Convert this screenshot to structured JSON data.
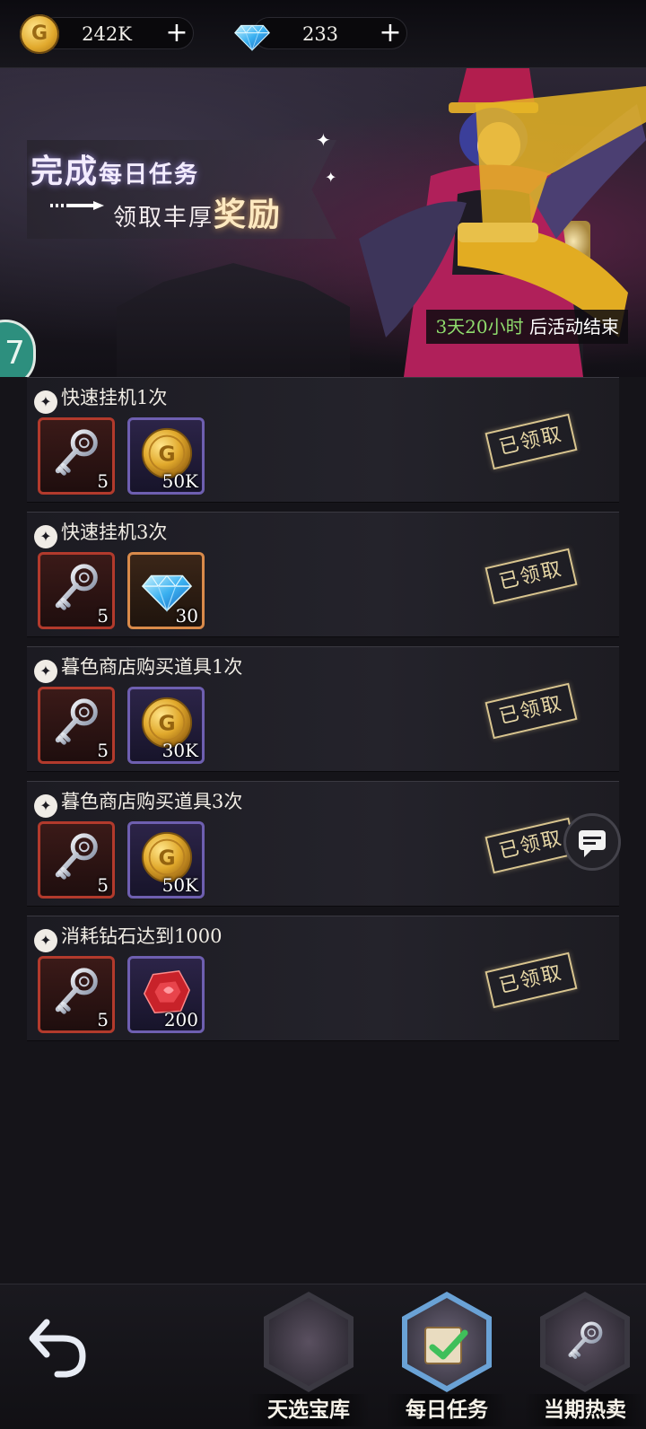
{
  "currency": {
    "gold": {
      "icon": "gold-coin-icon",
      "value": "242K",
      "plus": "+"
    },
    "gems": {
      "icon": "diamond-icon",
      "value": "233",
      "plus": "+"
    }
  },
  "banner": {
    "title_big_1": "完成",
    "title_small_1": "每日任务",
    "title_small_2": "领取丰厚",
    "title_big_2": "奖励",
    "countdown_time": "3天20小时",
    "countdown_suffix": " 后活动结束",
    "side_badge": "7"
  },
  "tasks": [
    {
      "title": "快速挂机1次",
      "rewards": [
        {
          "icon": "key-icon",
          "qty": "5"
        },
        {
          "icon": "gold-coin-icon",
          "qty": "50K"
        }
      ],
      "status": "已领取"
    },
    {
      "title": "快速挂机3次",
      "rewards": [
        {
          "icon": "key-icon",
          "qty": "5"
        },
        {
          "icon": "diamond-icon",
          "qty": "30"
        }
      ],
      "status": "已领取"
    },
    {
      "title": "暮色商店购买道具1次",
      "rewards": [
        {
          "icon": "key-icon",
          "qty": "5"
        },
        {
          "icon": "gold-coin-icon",
          "qty": "30K"
        }
      ],
      "status": "已领取"
    },
    {
      "title": "暮色商店购买道具3次",
      "rewards": [
        {
          "icon": "key-icon",
          "qty": "5"
        },
        {
          "icon": "gold-coin-icon",
          "qty": "50K"
        }
      ],
      "status": "已领取"
    },
    {
      "title": "消耗钻石达到1000",
      "rewards": [
        {
          "icon": "key-icon",
          "qty": "5"
        },
        {
          "icon": "red-gem-icon",
          "qty": "200"
        }
      ],
      "status": "已领取"
    }
  ],
  "nav": {
    "items": [
      {
        "label": "天选宝库",
        "active": false
      },
      {
        "label": "每日任务",
        "active": true
      },
      {
        "label": "当期热卖",
        "active": false
      }
    ]
  },
  "colors": {
    "background": "#151419",
    "countdown_time": "#8fdc6d",
    "stamp": "#d9c58f",
    "slot_red": "#b23a2c",
    "slot_purple": "#6e5fb0",
    "slot_orange": "#d98a4a",
    "nav_active": "#6aa2d6"
  }
}
